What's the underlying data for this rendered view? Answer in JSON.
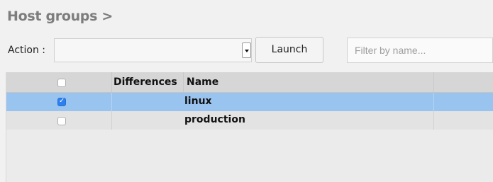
{
  "page": {
    "title": "Host groups >"
  },
  "toolbar": {
    "action_label": "Action :",
    "action_value": "",
    "launch_label": "Launch",
    "filter_placeholder": "Filter by name..."
  },
  "table": {
    "columns": [
      "",
      "Differences",
      "Name"
    ],
    "rows": [
      {
        "checked": true,
        "name": "linux"
      },
      {
        "checked": false,
        "name": "production"
      }
    ]
  },
  "colors": {
    "selected_row": "#9ac4f0",
    "header_bg": "#d6d6d6",
    "checkbox_checked": "#2d7ff0"
  }
}
